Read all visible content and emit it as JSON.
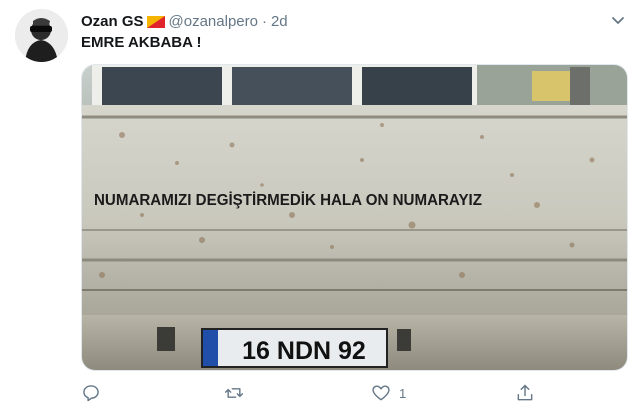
{
  "tweet": {
    "author_name": "Ozan GS",
    "author_handle": "@ozanalpero",
    "separator": "·",
    "time": "2d",
    "text": "EMRE AKBABA !",
    "media": {
      "truck_text": "NUMARAMIZI DEGİŞTİRMEDİK HALA ON NUMARAYIZ",
      "plate": "16 NDN 92"
    },
    "actions": {
      "reply_count": "",
      "retweet_count": "",
      "like_count": "1"
    }
  },
  "colors": {
    "text": "#14171a",
    "muted": "#657786",
    "icon": "#657786"
  },
  "icons": [
    "avatar",
    "flag-icon",
    "chevron-down-icon",
    "reply-icon",
    "retweet-icon",
    "like-icon",
    "share-icon"
  ]
}
